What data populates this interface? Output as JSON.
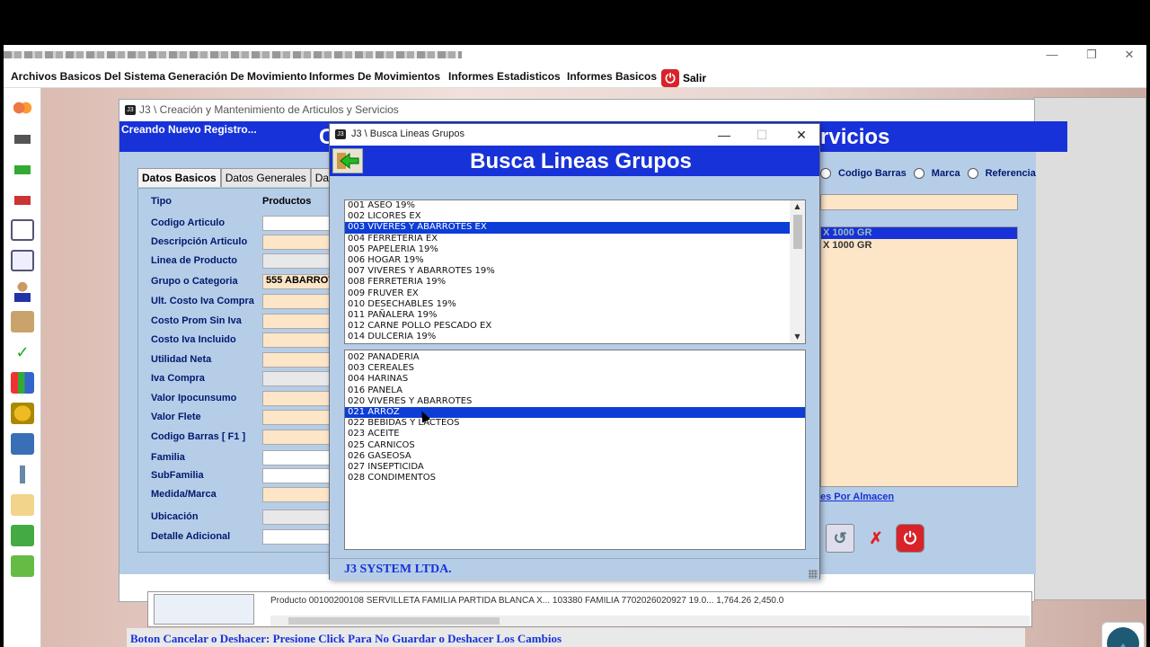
{
  "menubar": {
    "items": [
      "Archivos Basicos Del Sistema",
      "Generación De Movimiento",
      "Informes De Movimientos",
      "Informes Estadisticos",
      "Informes Basicos"
    ],
    "exit_label": "Salir"
  },
  "bg_window": {
    "title": "J3 \\ Creación y Mantenimiento de Articulos y Servicios",
    "new_record": "Creando Nuevo Registro...",
    "header_left": "C",
    "header_right": "rvicios",
    "tabs": [
      "Datos Basicos",
      "Datos Generales",
      "Dat"
    ],
    "tipo_value": "Productos",
    "fields": [
      "Tipo",
      "Codigo Articulo",
      "Descripción Articulo",
      "Linea de Producto",
      "Grupo o Categoria",
      "Ult. Costo Iva Compra",
      "Costo Prom Sin Iva",
      "Costo Iva Incluido",
      "Utilidad Neta",
      "Iva Compra",
      "Valor Ipocunsumo",
      "Valor Flete",
      "Codigo Barras  [ F1 ]",
      "Familia",
      "SubFamilia",
      "Medida/Marca",
      "Ubicación",
      "Detalle Adicional"
    ],
    "grupo_value": "555 ABARROT",
    "radio_labels": [
      "Codigo Barras",
      "Marca",
      "Referencia"
    ],
    "right_list_selected": "X 1000 GR",
    "right_list_row": "X 1000 GR",
    "almacen_link": "es Por Almacen",
    "hint": "Boton Cancelar o Deshacer: Presione Click Para No Guardar o Deshacer Los Cambios",
    "grid_row": "Producto    00100200108    SERVILLETA FAMILIA PARTIDA BLANCA  X...    103380          FAMILIA                 7702026020927    19.0...              1,764.26                    2,450.0"
  },
  "dialog": {
    "title": "J3 \\ Busca Lineas Grupos",
    "header": "Busca Lineas Grupos",
    "lineas": [
      "001 ASEO 19%",
      "002 LICORES EX",
      "003 VIVERES Y ABARROTES EX",
      "004 FERRETERIA EX",
      "005 PAPELERIA 19%",
      "006 HOGAR 19%",
      "007 VIVERES Y ABARROTES 19%",
      "008 FERRETERIA 19%",
      "009 FRUVER EX",
      "010 DESECHABLES 19%",
      "011 PAÑALERA 19%",
      "012 CARNE POLLO PESCADO EX",
      "014 DULCERIA 19%"
    ],
    "lineas_selected_index": 2,
    "grupos": [
      "002 PANADERIA",
      "003 CEREALES",
      "004 HARINAS",
      "016 PANELA",
      "020 VIVERES Y ABARROTES",
      "021 ARROZ",
      "022 BEBIDAS Y LACTEOS",
      "023 ACEITE",
      "025 CARNICOS",
      "026 GASEOSA",
      "027 INSEPTICIDA",
      "028 CONDIMENTOS"
    ],
    "grupos_selected_index": 5,
    "footer": "J3 SYSTEM LTDA."
  },
  "colors": {
    "header_blue": "#1732d8",
    "selection_blue": "#0c3dd6",
    "form_bg": "#b6cde8",
    "input_bg": "#fde5c8"
  },
  "icons": [
    "back-arrow-icon",
    "minimize-icon",
    "maximize-icon",
    "close-icon",
    "power-icon"
  ]
}
